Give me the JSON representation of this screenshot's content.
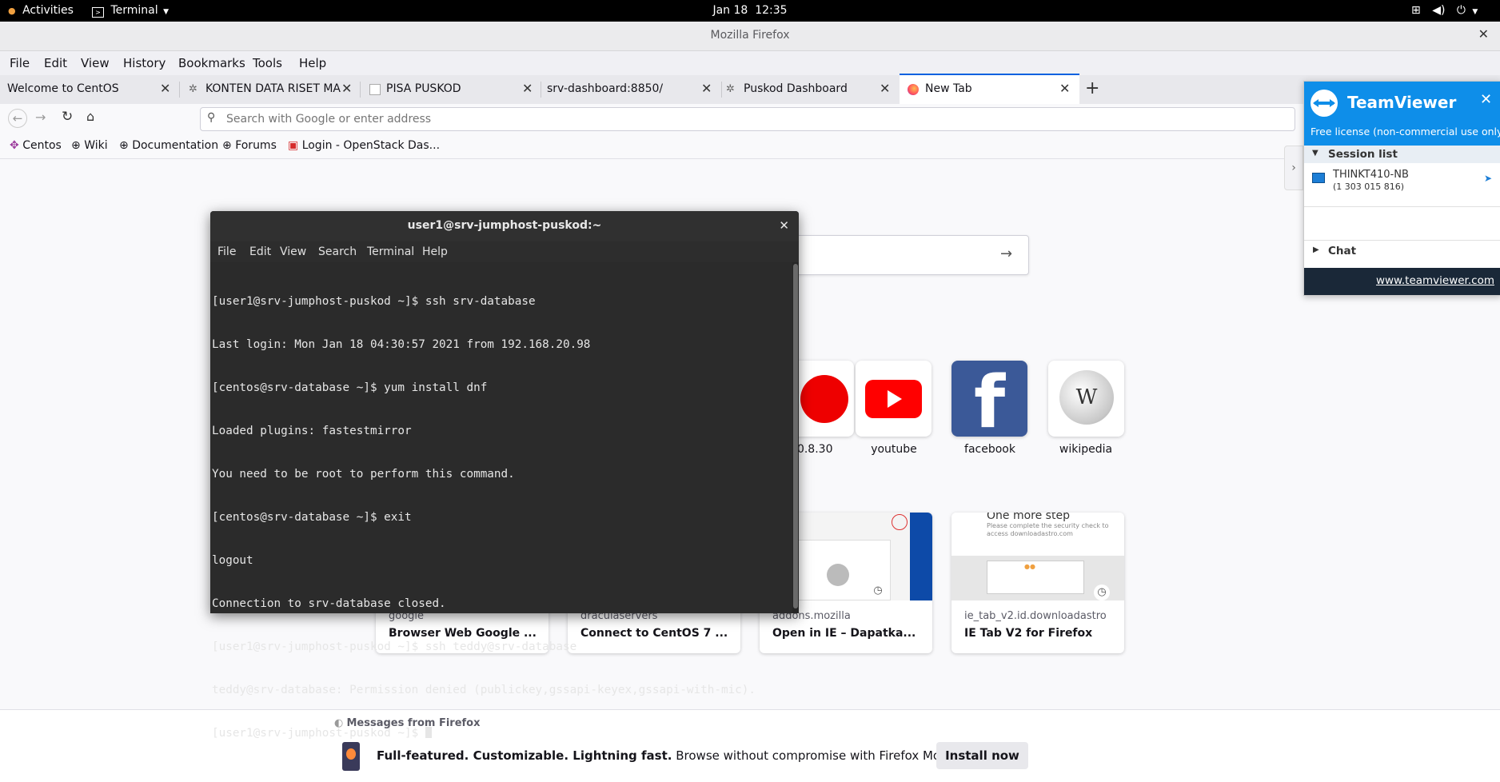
{
  "topbar": {
    "activities": "Activities",
    "app_menu": "Terminal",
    "clock": "Jan 18  12:35"
  },
  "firefox": {
    "window_title": "Mozilla Firefox",
    "menu": [
      "File",
      "Edit",
      "View",
      "History",
      "Bookmarks",
      "Tools",
      "Help"
    ],
    "tabs": [
      {
        "label": "Welcome to CentOS"
      },
      {
        "label": "KONTEN DATA RISET MA"
      },
      {
        "label": "PISA PUSKOD"
      },
      {
        "label": "srv-dashboard:8850/"
      },
      {
        "label": "Puskod Dashboard"
      },
      {
        "label": "New Tab"
      }
    ],
    "new_tab_symbol": "+",
    "url_placeholder": "Search with Google or enter address",
    "bookmarks": [
      "Centos",
      "Wiki",
      "Documentation",
      "Forums",
      "Login - OpenStack Das..."
    ],
    "top_sites": [
      {
        "label": ".0.8.30"
      },
      {
        "label": "youtube"
      },
      {
        "label": "facebook"
      },
      {
        "label": "wikipedia"
      }
    ],
    "highlights": [
      {
        "host": "google",
        "title": "Browser Web Google ..."
      },
      {
        "host": "draculaservers",
        "title": "Connect to CentOS 7 ..."
      },
      {
        "host": "addons.mozilla",
        "title": "Open in IE – Dapatka..."
      },
      {
        "host": "ie_tab_v2.id.downloadastro",
        "title": "IE Tab V2 for Firefox",
        "thumb_heading": "One more step",
        "thumb_text": "Please complete the security check to access downloadastro.com"
      }
    ],
    "messages": {
      "heading": "Messages from Firefox",
      "bold": "Full-featured. Customizable. Lightning fast.",
      "text": "Browse without compromise with Firefox Mobile.",
      "button": "Install now"
    }
  },
  "terminal": {
    "title": "user1@srv-jumphost-puskod:~",
    "menu": [
      "File",
      "Edit",
      "View",
      "Search",
      "Terminal",
      "Help"
    ],
    "lines": [
      "[user1@srv-jumphost-puskod ~]$ ssh srv-database",
      "Last login: Mon Jan 18 04:30:57 2021 from 192.168.20.98",
      "[centos@srv-database ~]$ yum install dnf",
      "Loaded plugins: fastestmirror",
      "You need to be root to perform this command.",
      "[centos@srv-database ~]$ exit",
      "logout",
      "Connection to srv-database closed.",
      "[user1@srv-jumphost-puskod ~]$ ssh teddy@srv-database",
      "teddy@srv-database: Permission denied (publickey,gssapi-keyex,gssapi-with-mic).",
      "[user1@srv-jumphost-puskod ~]$ "
    ]
  },
  "teamviewer": {
    "brand": "TeamViewer",
    "license": "Free license (non-commercial use only)",
    "session_list": "Session list",
    "session_name": "THINKT410-NB",
    "session_id": "(1 303 015 816)",
    "chat": "Chat",
    "link": "www.teamviewer.com"
  },
  "colors": {
    "accent": "#0061e0",
    "teamviewer_blue": "#0e8ee9",
    "terminal_bg": "#2b2b2b"
  }
}
